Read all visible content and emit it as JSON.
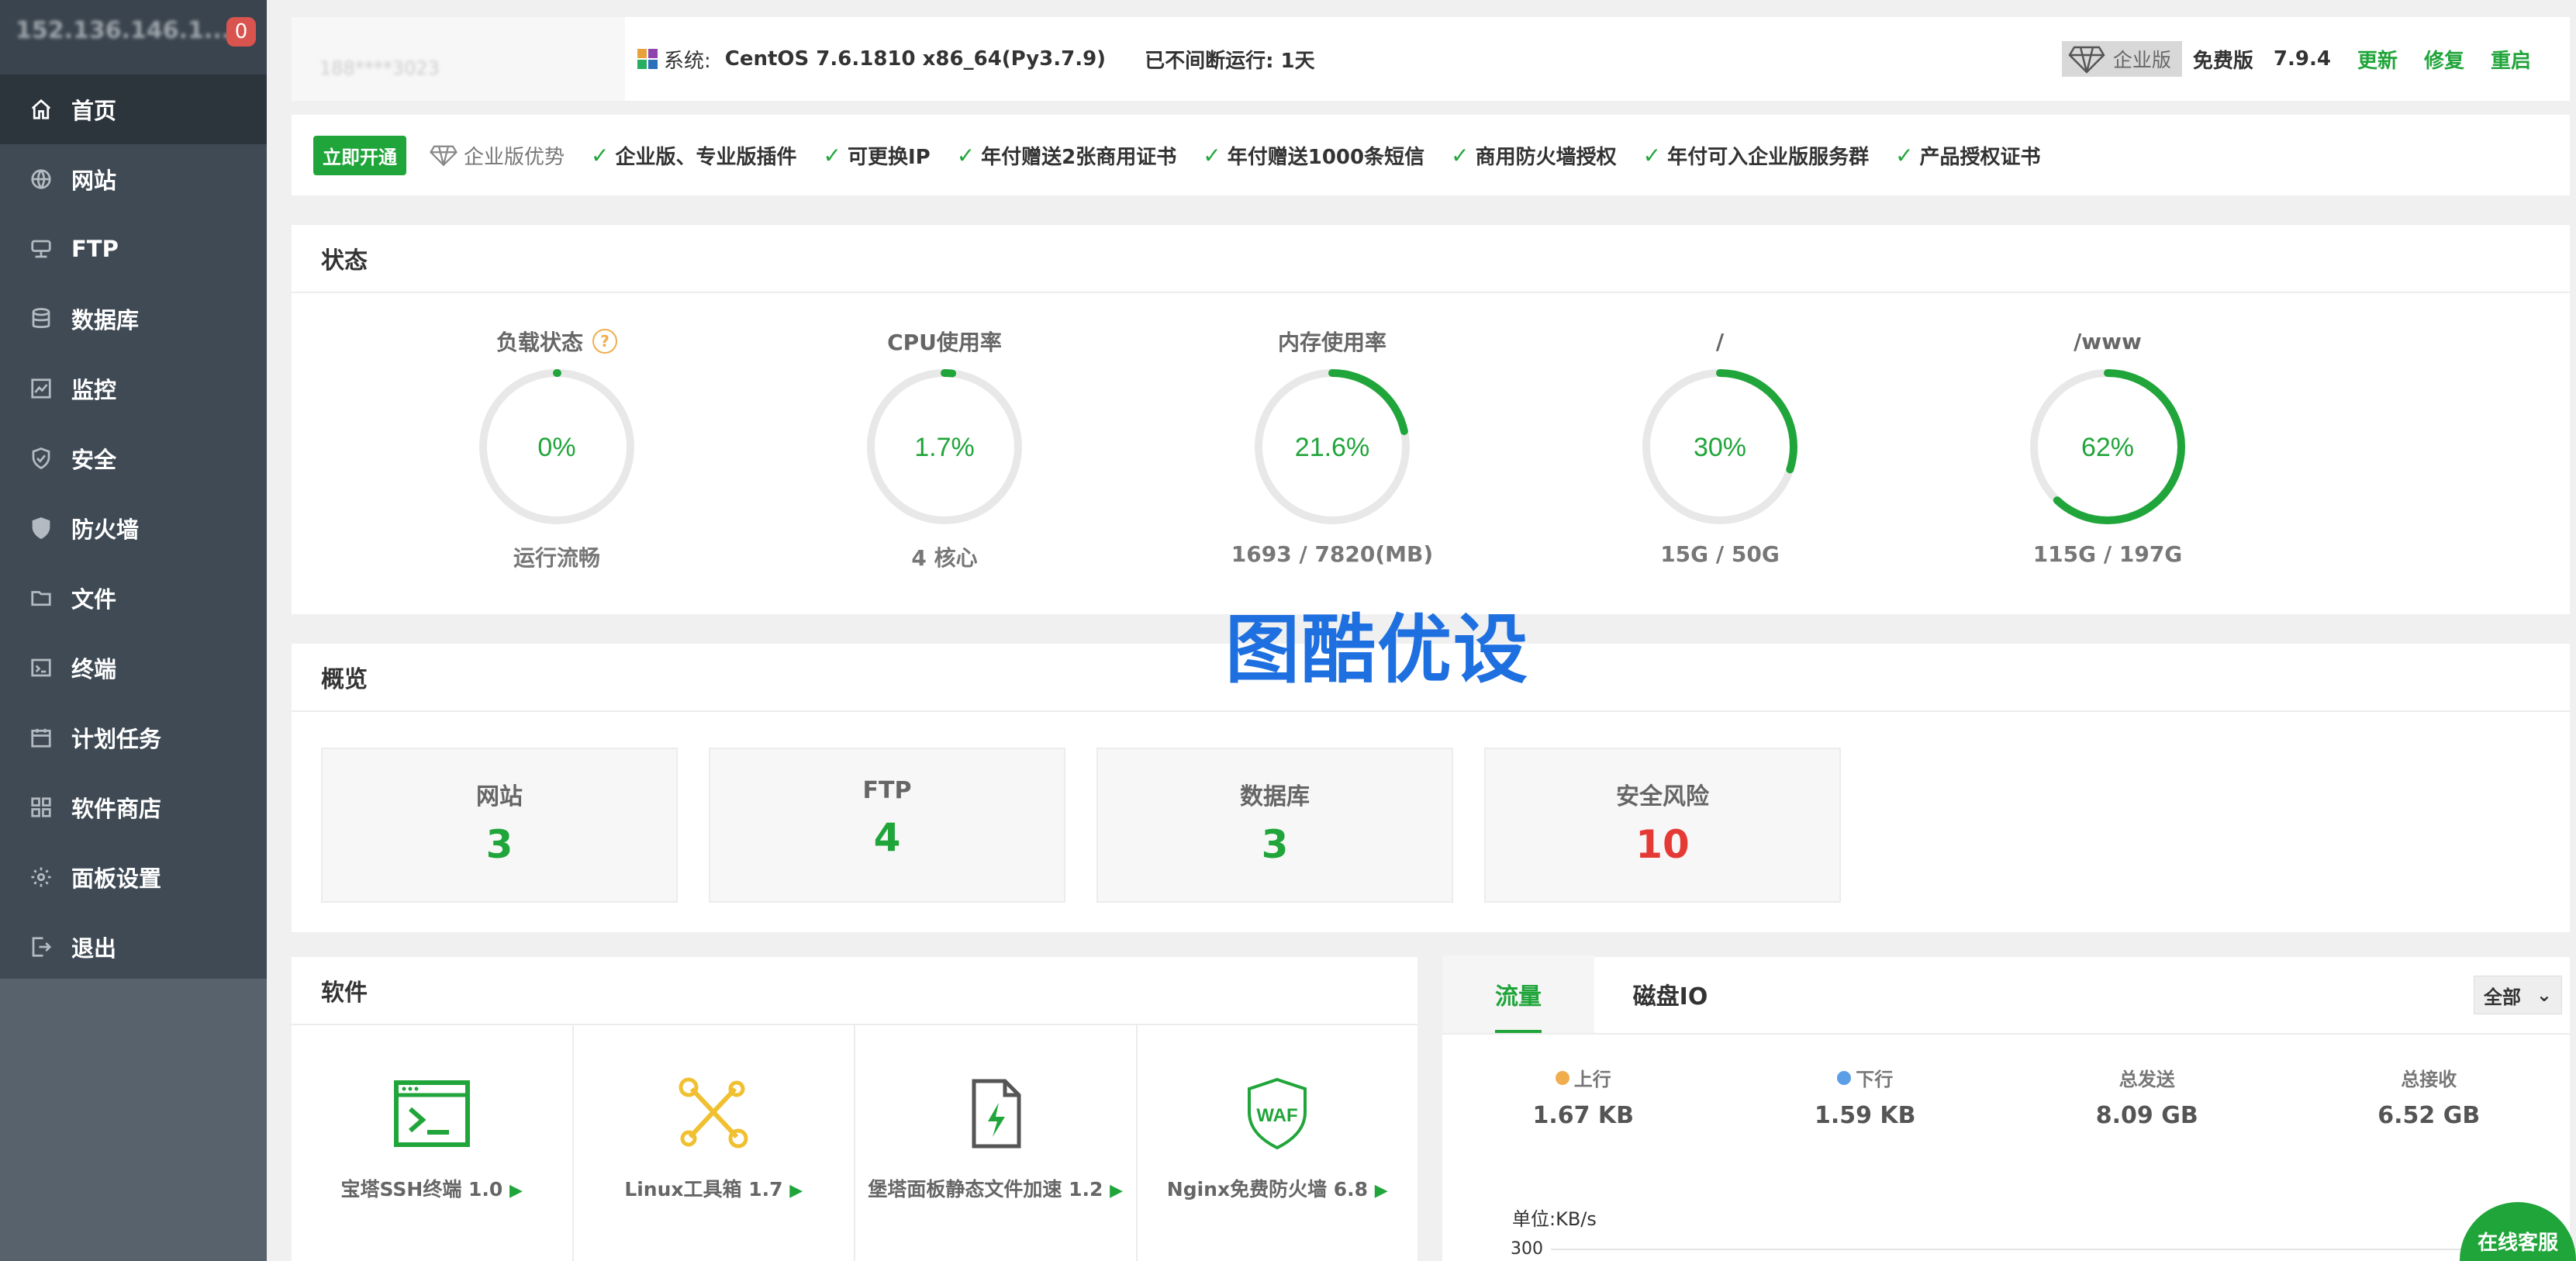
{
  "sidebar": {
    "ip": "152.136.146.1...",
    "badge": "0",
    "items": [
      {
        "label": "首页",
        "icon": "home-icon"
      },
      {
        "label": "网站",
        "icon": "globe-icon"
      },
      {
        "label": "FTP",
        "icon": "ftp-icon"
      },
      {
        "label": "数据库",
        "icon": "database-icon"
      },
      {
        "label": "监控",
        "icon": "monitor-icon"
      },
      {
        "label": "安全",
        "icon": "shield-check-icon"
      },
      {
        "label": "防火墙",
        "icon": "firewall-shield-icon"
      },
      {
        "label": "文件",
        "icon": "folder-icon"
      },
      {
        "label": "终端",
        "icon": "terminal-icon"
      },
      {
        "label": "计划任务",
        "icon": "calendar-icon"
      },
      {
        "label": "软件商店",
        "icon": "grid-icon"
      },
      {
        "label": "面板设置",
        "icon": "gear-icon"
      },
      {
        "label": "退出",
        "icon": "logout-icon"
      }
    ]
  },
  "topbar": {
    "user": "188****3023",
    "sys_label": "系统:",
    "sys_value": "CentOS 7.6.1810 x86_64(Py3.7.9)",
    "uptime": "已不间断运行: 1天",
    "enterprise": "企业版",
    "free": "免费版",
    "version": "7.9.4",
    "update": "更新",
    "repair": "修复",
    "restart": "重启"
  },
  "promo": {
    "button": "立即开通",
    "enterprise": "企业版优势",
    "features": [
      "企业版、专业版插件",
      "可更换IP",
      "年付赠送2张商用证书",
      "年付赠送1000条短信",
      "商用防火墙授权",
      "年付可入企业版服务群",
      "产品授权证书"
    ]
  },
  "status": {
    "title": "状态",
    "gauges": [
      {
        "label": "负载状态",
        "value": "0%",
        "sub": "运行流畅",
        "pct": 0
      },
      {
        "label": "CPU使用率",
        "value": "1.7%",
        "sub": "4 核心",
        "pct": 1.7
      },
      {
        "label": "内存使用率",
        "value": "21.6%",
        "sub": "1693 / 7820(MB)",
        "pct": 21.6
      },
      {
        "label": "/",
        "value": "30%",
        "sub": "15G / 50G",
        "pct": 30
      },
      {
        "label": "/www",
        "value": "62%",
        "sub": "115G / 197G",
        "pct": 62
      }
    ]
  },
  "overview": {
    "title": "概览",
    "items": [
      {
        "label": "网站",
        "value": "3"
      },
      {
        "label": "FTP",
        "value": "4"
      },
      {
        "label": "数据库",
        "value": "3"
      },
      {
        "label": "安全风险",
        "value": "10"
      }
    ]
  },
  "software": {
    "title": "软件",
    "items": [
      {
        "label": "宝塔SSH终端 1.0",
        "icon": "ssh-terminal-icon"
      },
      {
        "label": "Linux工具箱 1.7",
        "icon": "tools-icon"
      },
      {
        "label": "堡塔面板静态文件加速 1.2",
        "icon": "file-accelerate-icon"
      },
      {
        "label": "Nginx免费防火墙 6.8",
        "icon": "waf-shield-icon"
      }
    ]
  },
  "traffic": {
    "tabs": [
      "流量",
      "磁盘IO"
    ],
    "select": "全部",
    "stats": [
      {
        "label": "上行",
        "value": "1.67 KB",
        "dot": "#f0ad4e"
      },
      {
        "label": "下行",
        "value": "1.59 KB",
        "dot": "#5b9ee6"
      },
      {
        "label": "总发送",
        "value": "8.09 GB"
      },
      {
        "label": "总接收",
        "value": "6.52 GB"
      }
    ],
    "unit": "单位:KB/s",
    "axis_top": "300"
  },
  "online": "在线客服",
  "watermark": "图酷优设",
  "colors": {
    "accent": "#20a53a",
    "danger": "#e53935",
    "sidebar": "#3f4a54"
  }
}
